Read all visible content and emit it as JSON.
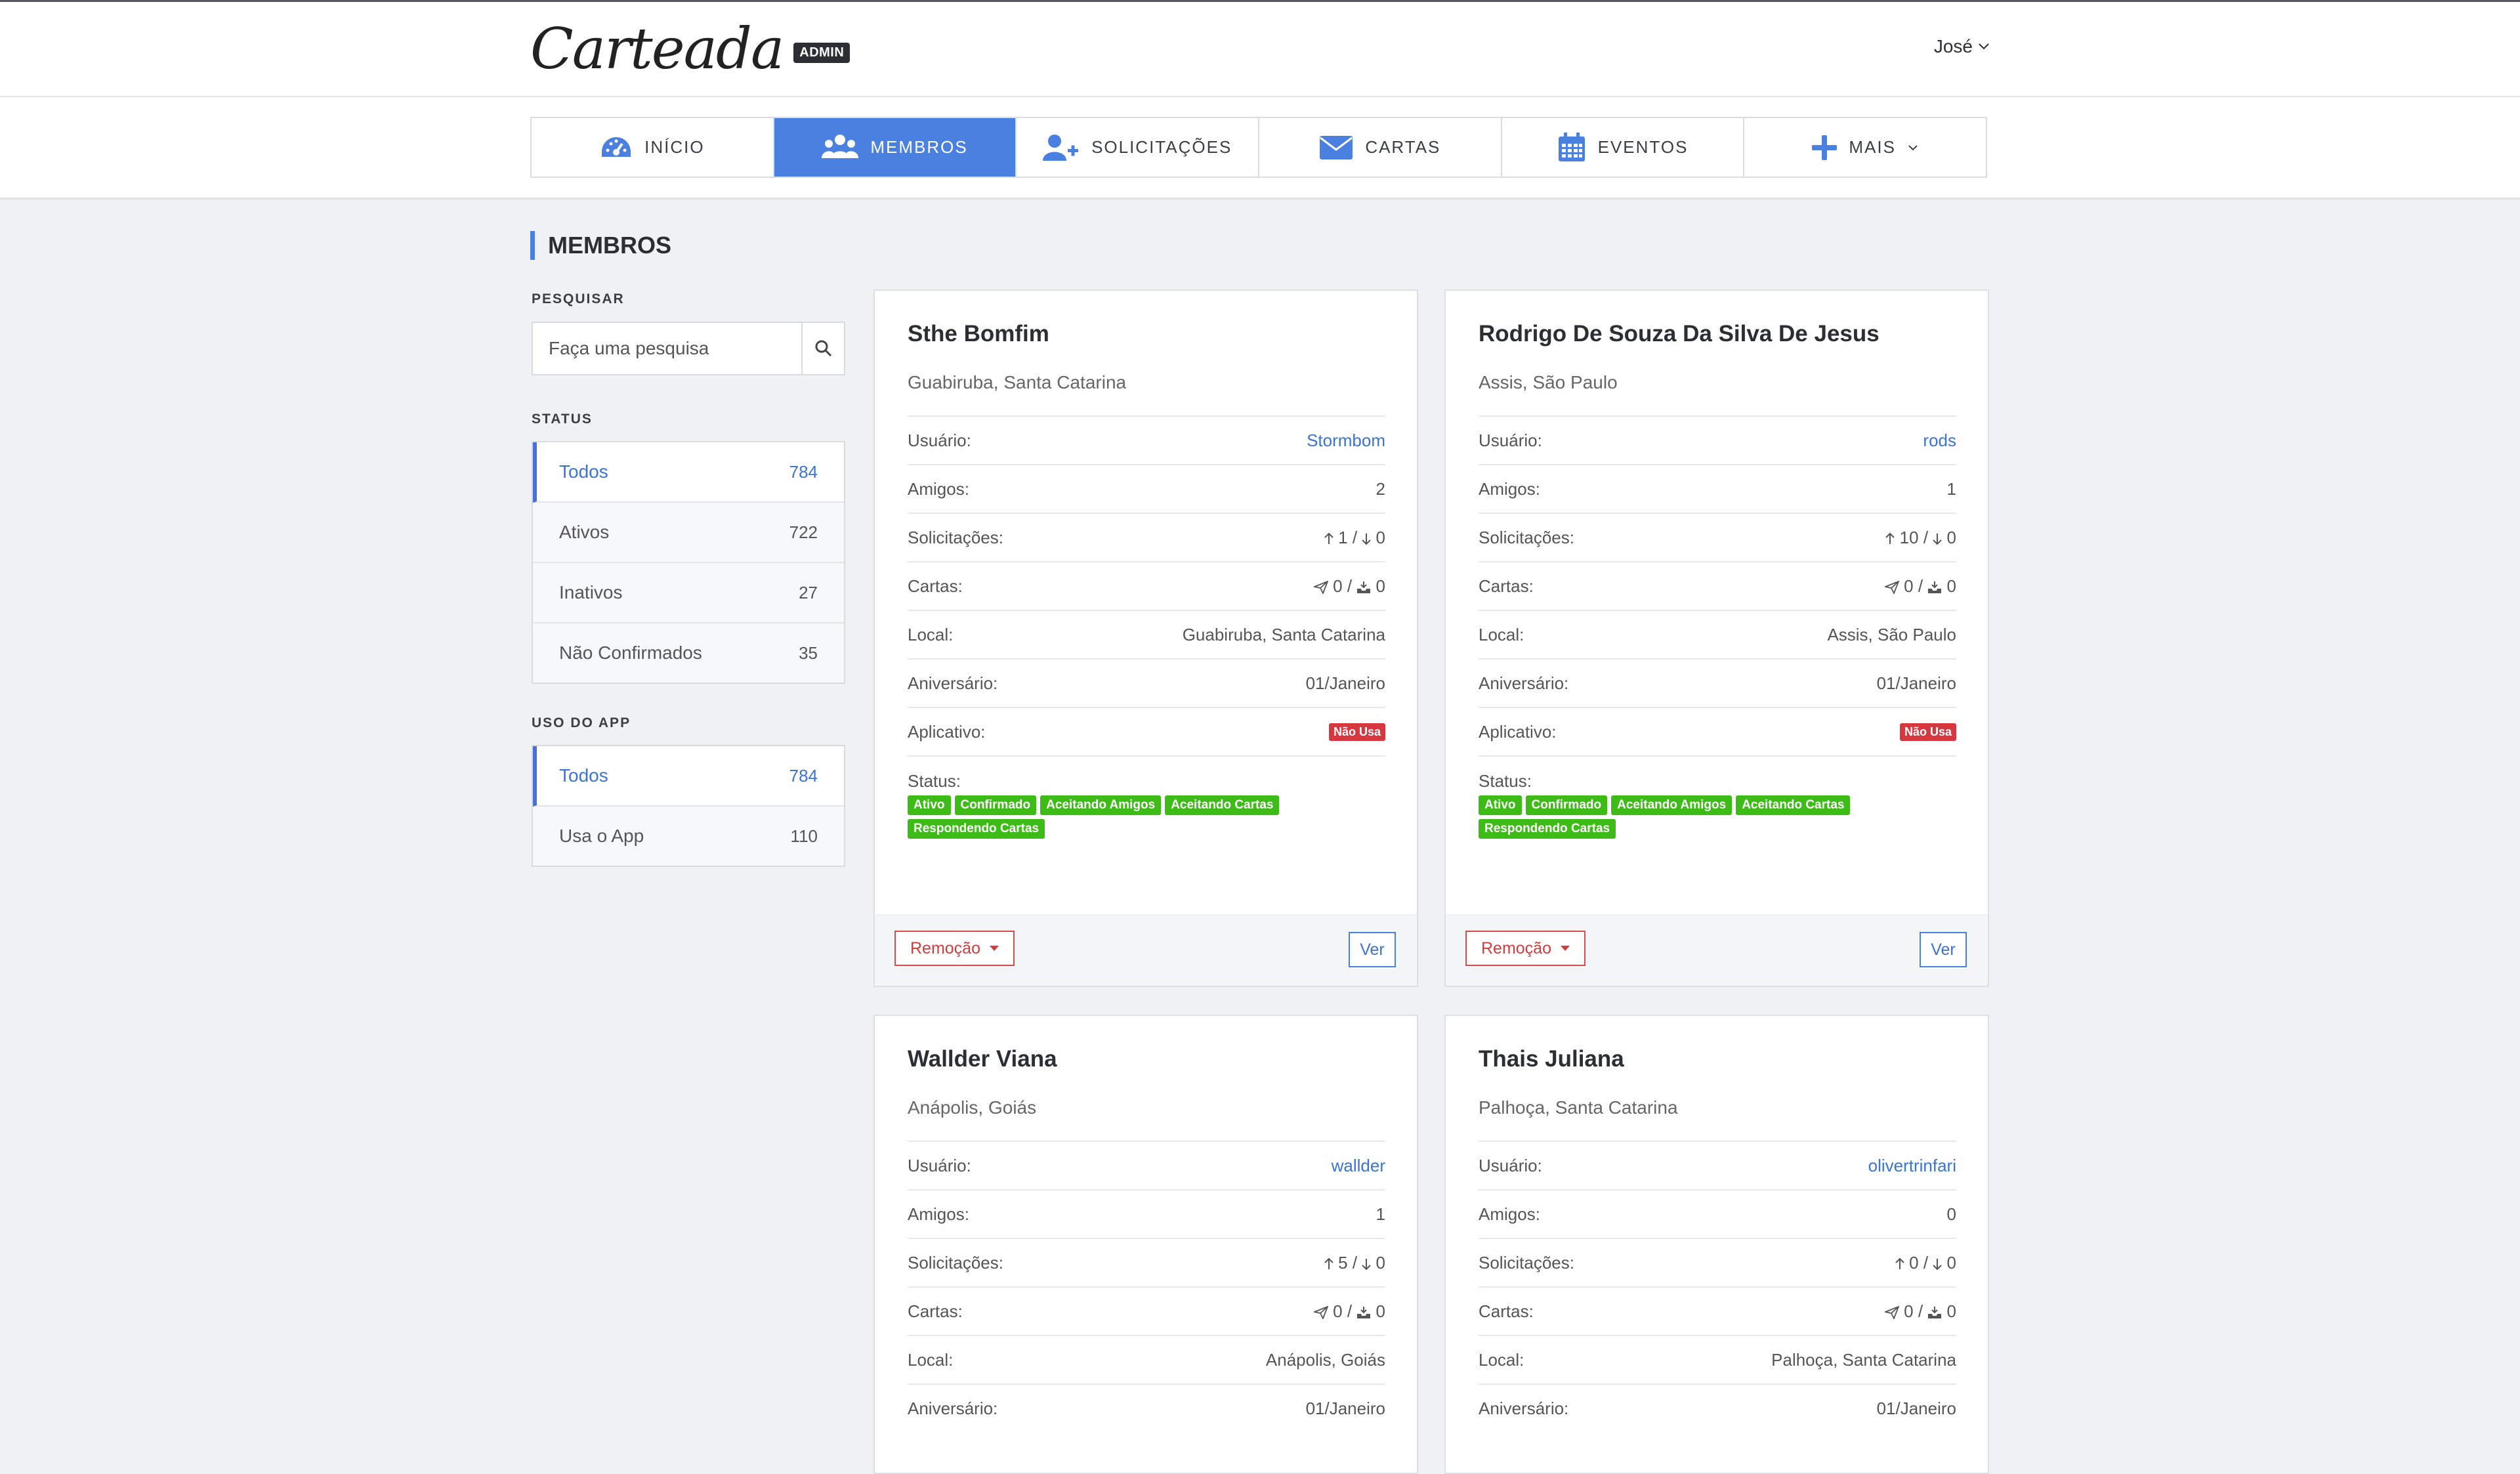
{
  "header": {
    "logo_text": "Carteada",
    "admin_badge": "ADMIN",
    "user_name": "José"
  },
  "nav": [
    {
      "label": "INÍCIO",
      "icon": "dashboard-icon"
    },
    {
      "label": "MEMBROS",
      "icon": "users-icon",
      "active": true
    },
    {
      "label": "SOLICITAÇÕES",
      "icon": "user-plus-icon"
    },
    {
      "label": "CARTAS",
      "icon": "envelope-icon"
    },
    {
      "label": "EVENTOS",
      "icon": "calendar-icon"
    },
    {
      "label": "MAIS",
      "icon": "plus-icon"
    }
  ],
  "page": {
    "title": "MEMBROS"
  },
  "sidebar": {
    "search_label": "PESQUISAR",
    "search_placeholder": "Faça uma pesquisa",
    "status_label": "STATUS",
    "status_items": [
      {
        "label": "Todos",
        "count": "784"
      },
      {
        "label": "Ativos",
        "count": "722"
      },
      {
        "label": "Inativos",
        "count": "27"
      },
      {
        "label": "Não Confirmados",
        "count": "35"
      }
    ],
    "app_label": "USO DO APP",
    "app_items": [
      {
        "label": "Todos",
        "count": "784"
      },
      {
        "label": "Usa o App",
        "count": "110"
      }
    ]
  },
  "labels": {
    "usuario": "Usuário:",
    "amigos": "Amigos:",
    "solicitacoes": "Solicitações:",
    "cartas": "Cartas:",
    "local": "Local:",
    "aniversario": "Aniversário:",
    "aplicativo": "Aplicativo:",
    "status": "Status:",
    "remove_button": "Remoção",
    "view_button": "Ver",
    "separator": "/"
  },
  "members": [
    {
      "name": "Sthe Bomfim",
      "location": "Guabiruba, Santa Catarina",
      "username": "Stormbom",
      "friends": "2",
      "req_sent": "1",
      "req_received": "0",
      "letters_sent": "0",
      "letters_received": "0",
      "local": "Guabiruba, Santa Catarina",
      "birthday": "01/Janeiro",
      "app": "Não Usa",
      "status": [
        "Ativo",
        "Confirmado",
        "Aceitando Amigos",
        "Aceitando Cartas",
        "Respondendo Cartas"
      ]
    },
    {
      "name": "Rodrigo De Souza Da Silva De Jesus",
      "location": "Assis, São Paulo",
      "username": "rods",
      "friends": "1",
      "req_sent": "10",
      "req_received": "0",
      "letters_sent": "0",
      "letters_received": "0",
      "local": "Assis, São Paulo",
      "birthday": "01/Janeiro",
      "app": "Não Usa",
      "status": [
        "Ativo",
        "Confirmado",
        "Aceitando Amigos",
        "Aceitando Cartas",
        "Respondendo Cartas"
      ]
    },
    {
      "name": "Wallder Viana",
      "location": "Anápolis, Goiás",
      "username": "wallder",
      "friends": "1",
      "req_sent": "5",
      "req_received": "0",
      "letters_sent": "0",
      "letters_received": "0",
      "local": "Anápolis, Goiás",
      "birthday": "01/Janeiro"
    },
    {
      "name": "Thais Juliana",
      "location": "Palhoça, Santa Catarina",
      "username": "olivertrinfari",
      "friends": "0",
      "req_sent": "0",
      "req_received": "0",
      "letters_sent": "0",
      "letters_received": "0",
      "local": "Palhoça, Santa Catarina",
      "birthday": "01/Janeiro"
    }
  ],
  "colors": {
    "accent": "#4a80e0",
    "danger": "#d7373f",
    "success": "#3dbb16",
    "background": "#f0f1f5"
  }
}
